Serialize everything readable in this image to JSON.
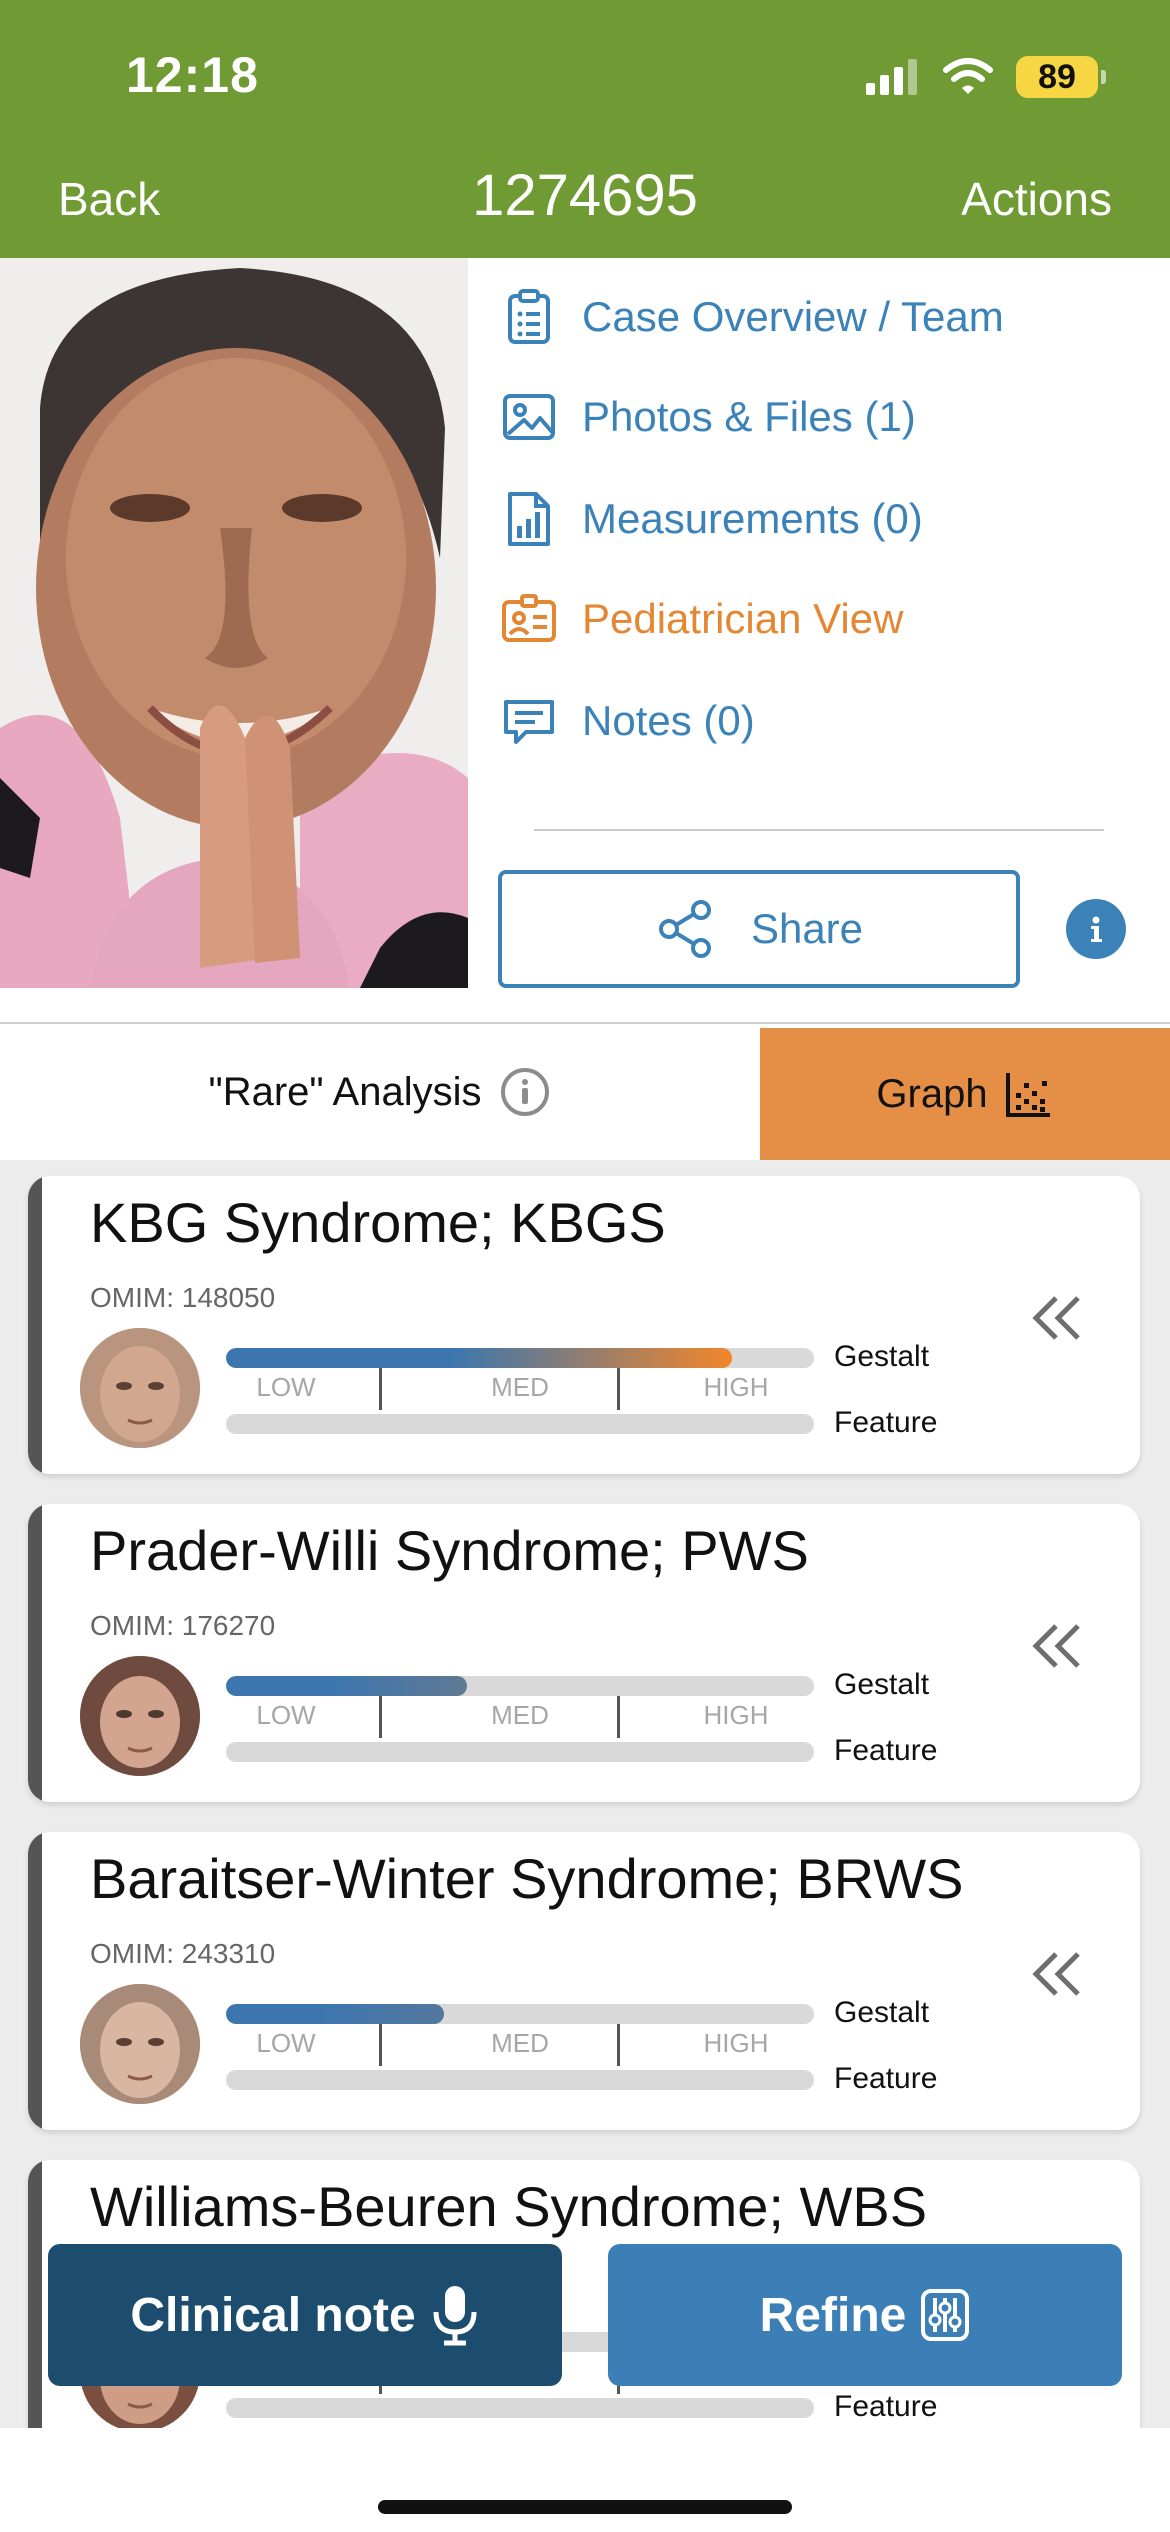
{
  "status_bar": {
    "time": "12:18",
    "battery": "89"
  },
  "nav": {
    "back_label": "Back",
    "title": "1274695",
    "actions_label": "Actions"
  },
  "menu": {
    "items": [
      {
        "label": "Case Overview / Team",
        "icon": "clipboard-list-icon"
      },
      {
        "label": "Photos & Files (1)",
        "icon": "image-icon"
      },
      {
        "label": "Measurements (0)",
        "icon": "chart-document-icon"
      },
      {
        "label": "Pediatrician View",
        "icon": "id-card-icon"
      },
      {
        "label": "Notes (0)",
        "icon": "chat-icon"
      }
    ],
    "share_label": "Share"
  },
  "tabs": {
    "rare_label": "\"Rare\" Analysis",
    "graph_label": "Graph"
  },
  "scale": {
    "low": "LOW",
    "med": "MED",
    "high": "HIGH",
    "gestalt": "Gestalt",
    "feature": "Feature"
  },
  "results": [
    {
      "title": "KBG Syndrome; KBGS",
      "omim": "OMIM: 148050",
      "gestalt_score": 0.86
    },
    {
      "title": "Prader-Willi Syndrome; PWS",
      "omim": "OMIM: 176270",
      "gestalt_score": 0.41
    },
    {
      "title": "Baraitser-Winter Syndrome; BRWS",
      "omim": "OMIM: 243310",
      "gestalt_score": 0.37
    },
    {
      "title": "Williams-Beuren Syndrome; WBS",
      "omim": "",
      "gestalt_score": 0.3
    }
  ],
  "bottom_buttons": {
    "clinical_note_label": "Clinical note",
    "refine_label": "Refine"
  },
  "colors": {
    "brand_green": "#709a33",
    "link_blue": "#3b82b8",
    "accent_orange": "#e48733",
    "dark_navy": "#1d4d6e"
  }
}
